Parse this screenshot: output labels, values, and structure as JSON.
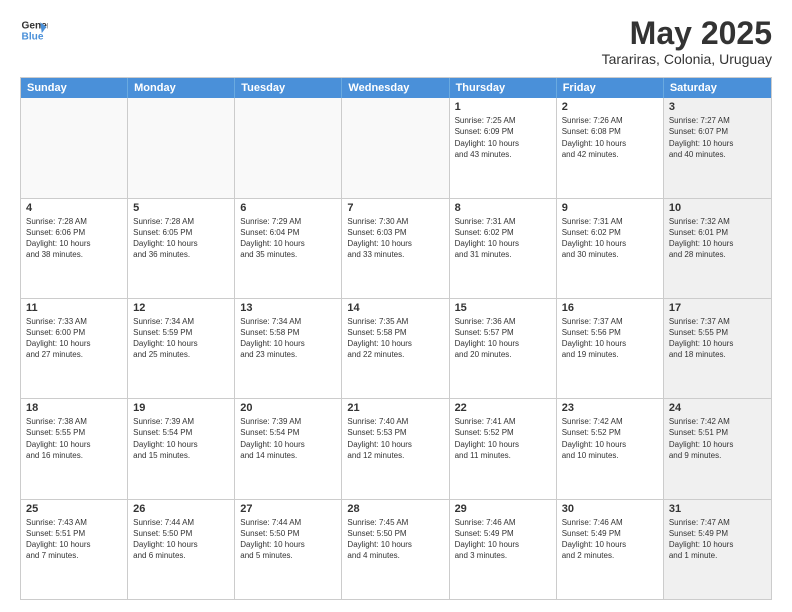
{
  "logo": {
    "line1": "General",
    "line2": "Blue"
  },
  "title": "May 2025",
  "subtitle": "Tarariras, Colonia, Uruguay",
  "days": [
    "Sunday",
    "Monday",
    "Tuesday",
    "Wednesday",
    "Thursday",
    "Friday",
    "Saturday"
  ],
  "weeks": [
    [
      {
        "day": "",
        "info": "",
        "empty": true
      },
      {
        "day": "",
        "info": "",
        "empty": true
      },
      {
        "day": "",
        "info": "",
        "empty": true
      },
      {
        "day": "",
        "info": "",
        "empty": true
      },
      {
        "day": "1",
        "info": "Sunrise: 7:25 AM\nSunset: 6:09 PM\nDaylight: 10 hours\nand 43 minutes."
      },
      {
        "day": "2",
        "info": "Sunrise: 7:26 AM\nSunset: 6:08 PM\nDaylight: 10 hours\nand 42 minutes."
      },
      {
        "day": "3",
        "info": "Sunrise: 7:27 AM\nSunset: 6:07 PM\nDaylight: 10 hours\nand 40 minutes.",
        "shaded": true
      }
    ],
    [
      {
        "day": "4",
        "info": "Sunrise: 7:28 AM\nSunset: 6:06 PM\nDaylight: 10 hours\nand 38 minutes."
      },
      {
        "day": "5",
        "info": "Sunrise: 7:28 AM\nSunset: 6:05 PM\nDaylight: 10 hours\nand 36 minutes."
      },
      {
        "day": "6",
        "info": "Sunrise: 7:29 AM\nSunset: 6:04 PM\nDaylight: 10 hours\nand 35 minutes."
      },
      {
        "day": "7",
        "info": "Sunrise: 7:30 AM\nSunset: 6:03 PM\nDaylight: 10 hours\nand 33 minutes."
      },
      {
        "day": "8",
        "info": "Sunrise: 7:31 AM\nSunset: 6:02 PM\nDaylight: 10 hours\nand 31 minutes."
      },
      {
        "day": "9",
        "info": "Sunrise: 7:31 AM\nSunset: 6:02 PM\nDaylight: 10 hours\nand 30 minutes."
      },
      {
        "day": "10",
        "info": "Sunrise: 7:32 AM\nSunset: 6:01 PM\nDaylight: 10 hours\nand 28 minutes.",
        "shaded": true
      }
    ],
    [
      {
        "day": "11",
        "info": "Sunrise: 7:33 AM\nSunset: 6:00 PM\nDaylight: 10 hours\nand 27 minutes."
      },
      {
        "day": "12",
        "info": "Sunrise: 7:34 AM\nSunset: 5:59 PM\nDaylight: 10 hours\nand 25 minutes."
      },
      {
        "day": "13",
        "info": "Sunrise: 7:34 AM\nSunset: 5:58 PM\nDaylight: 10 hours\nand 23 minutes."
      },
      {
        "day": "14",
        "info": "Sunrise: 7:35 AM\nSunset: 5:58 PM\nDaylight: 10 hours\nand 22 minutes."
      },
      {
        "day": "15",
        "info": "Sunrise: 7:36 AM\nSunset: 5:57 PM\nDaylight: 10 hours\nand 20 minutes."
      },
      {
        "day": "16",
        "info": "Sunrise: 7:37 AM\nSunset: 5:56 PM\nDaylight: 10 hours\nand 19 minutes."
      },
      {
        "day": "17",
        "info": "Sunrise: 7:37 AM\nSunset: 5:55 PM\nDaylight: 10 hours\nand 18 minutes.",
        "shaded": true
      }
    ],
    [
      {
        "day": "18",
        "info": "Sunrise: 7:38 AM\nSunset: 5:55 PM\nDaylight: 10 hours\nand 16 minutes."
      },
      {
        "day": "19",
        "info": "Sunrise: 7:39 AM\nSunset: 5:54 PM\nDaylight: 10 hours\nand 15 minutes."
      },
      {
        "day": "20",
        "info": "Sunrise: 7:39 AM\nSunset: 5:54 PM\nDaylight: 10 hours\nand 14 minutes."
      },
      {
        "day": "21",
        "info": "Sunrise: 7:40 AM\nSunset: 5:53 PM\nDaylight: 10 hours\nand 12 minutes."
      },
      {
        "day": "22",
        "info": "Sunrise: 7:41 AM\nSunset: 5:52 PM\nDaylight: 10 hours\nand 11 minutes."
      },
      {
        "day": "23",
        "info": "Sunrise: 7:42 AM\nSunset: 5:52 PM\nDaylight: 10 hours\nand 10 minutes."
      },
      {
        "day": "24",
        "info": "Sunrise: 7:42 AM\nSunset: 5:51 PM\nDaylight: 10 hours\nand 9 minutes.",
        "shaded": true
      }
    ],
    [
      {
        "day": "25",
        "info": "Sunrise: 7:43 AM\nSunset: 5:51 PM\nDaylight: 10 hours\nand 7 minutes."
      },
      {
        "day": "26",
        "info": "Sunrise: 7:44 AM\nSunset: 5:50 PM\nDaylight: 10 hours\nand 6 minutes."
      },
      {
        "day": "27",
        "info": "Sunrise: 7:44 AM\nSunset: 5:50 PM\nDaylight: 10 hours\nand 5 minutes."
      },
      {
        "day": "28",
        "info": "Sunrise: 7:45 AM\nSunset: 5:50 PM\nDaylight: 10 hours\nand 4 minutes."
      },
      {
        "day": "29",
        "info": "Sunrise: 7:46 AM\nSunset: 5:49 PM\nDaylight: 10 hours\nand 3 minutes."
      },
      {
        "day": "30",
        "info": "Sunrise: 7:46 AM\nSunset: 5:49 PM\nDaylight: 10 hours\nand 2 minutes."
      },
      {
        "day": "31",
        "info": "Sunrise: 7:47 AM\nSunset: 5:49 PM\nDaylight: 10 hours\nand 1 minute.",
        "shaded": true
      }
    ]
  ]
}
